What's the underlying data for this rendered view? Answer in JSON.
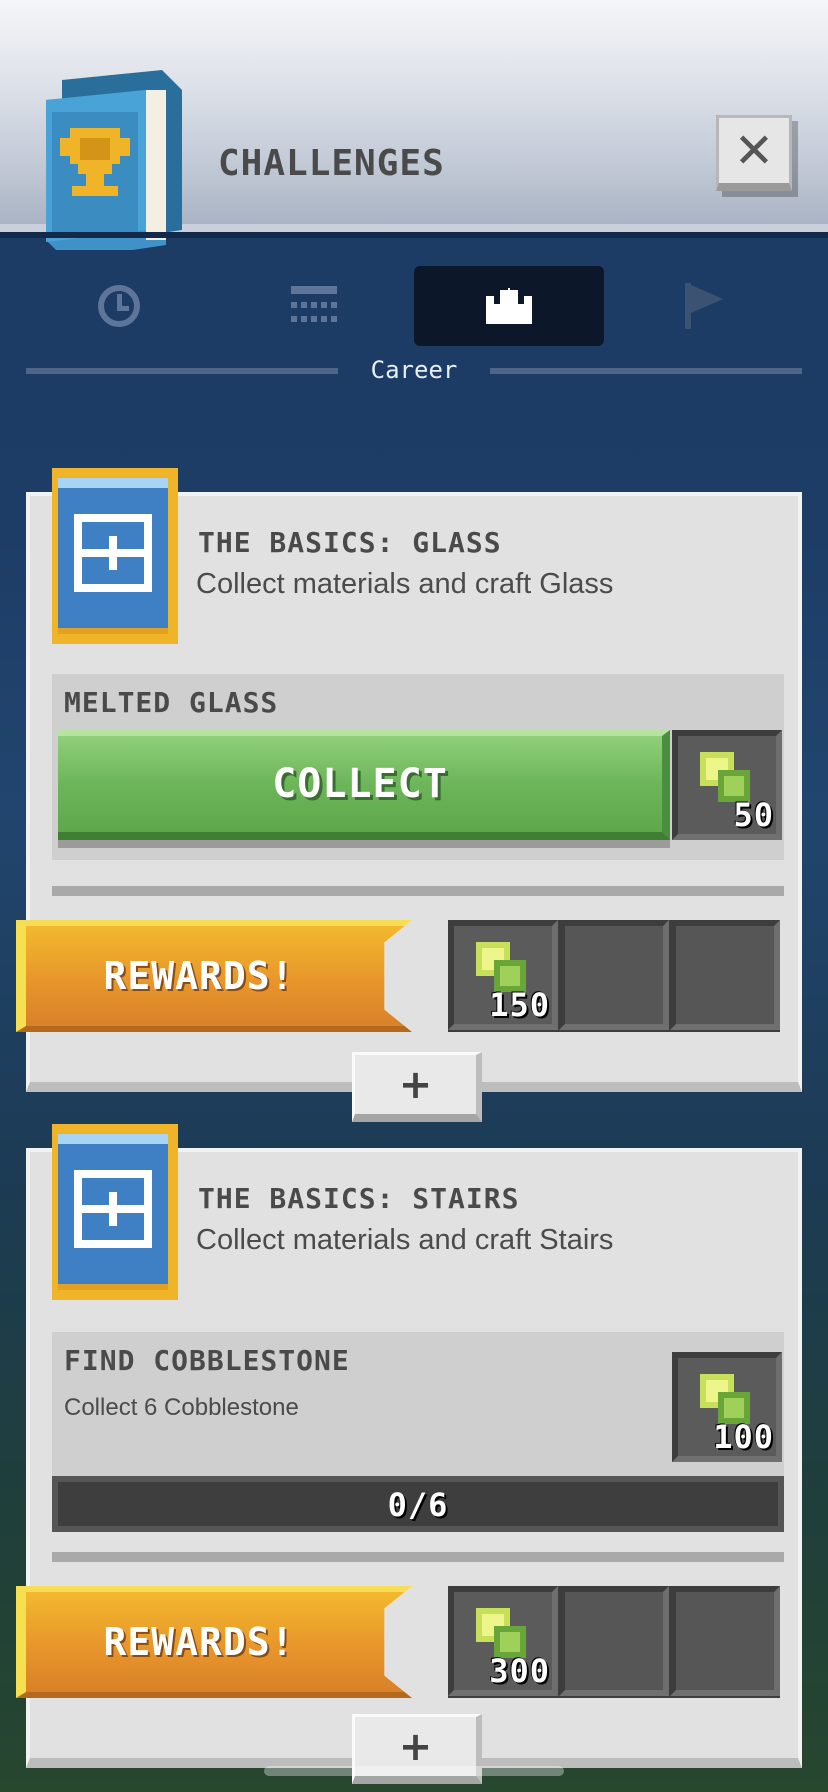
{
  "header": {
    "title": "CHALLENGES",
    "close_label": "✕"
  },
  "tabs": [
    {
      "id": "daily",
      "icon": "clock-icon"
    },
    {
      "id": "calendar",
      "icon": "calendar-icon"
    },
    {
      "id": "career",
      "icon": "crown-icon",
      "active": true
    },
    {
      "id": "events",
      "icon": "flag-icon"
    }
  ],
  "active_tab_label": "Career",
  "challenges": [
    {
      "title": "THE BASICS: GLASS",
      "subtitle": "Collect materials and craft Glass",
      "task": {
        "title": "MELTED GLASS",
        "action_label": "COLLECT",
        "reward_value": "50"
      },
      "rewards_label": "REWARDS!",
      "rewards": [
        "150",
        "",
        ""
      ],
      "expand_label": "+"
    },
    {
      "title": "THE BASICS: STAIRS",
      "subtitle": "Collect materials and craft Stairs",
      "task": {
        "title": "FIND COBBLESTONE",
        "description": "Collect 6 Cobblestone",
        "reward_value": "100",
        "progress": "0/6",
        "progress_fraction": 0
      },
      "rewards_label": "REWARDS!",
      "rewards": [
        "300",
        "",
        ""
      ],
      "expand_label": "+"
    }
  ],
  "colors": {
    "accent_green": "#6db55a",
    "accent_gold": "#e8962b",
    "card_bg": "#e1e1e1",
    "header_bg": "#dfe3ea"
  }
}
